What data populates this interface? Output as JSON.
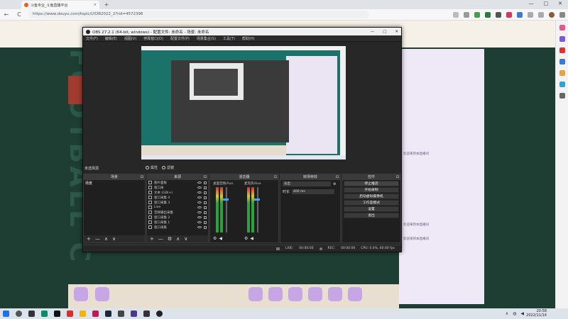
{
  "browser": {
    "tab_title": "斗鱼专业_斗鱼直播平台",
    "tab_close": "×",
    "new_tab": "+",
    "url": "https://www.douyu.com/topic/LYDB2022_2?rid=4572396",
    "nav": {
      "back": "←",
      "refresh": "C"
    },
    "window_controls": {
      "minimize": "—",
      "maximize": "□",
      "close": "✕"
    }
  },
  "page": {
    "watermark": "FOOTBALL C",
    "chat_lines": [
      "欢迎来到本直播间",
      "欢迎来到本直播间",
      "欢迎来到本直播间"
    ]
  },
  "obs": {
    "title": "OBS 27.2.1 (64-bit, windows) - 配置文件: 未命名 - 场景: 未命名",
    "window_controls": {
      "minimize": "—",
      "maximize": "□",
      "close": "✕"
    },
    "menu": [
      "文件(F)",
      "编辑(E)",
      "视图(V)",
      "停靠窗口(D)",
      "配置文件(P)",
      "场景集合(S)",
      "工具(T)",
      "帮助(H)"
    ],
    "no_source_label": "未选择源",
    "properties_label": "属性",
    "filters_label": "滤镜",
    "docks": {
      "scenes": "场景",
      "sources": "来源",
      "mixer": "混音器",
      "transitions": "转场特效",
      "controls": "控件"
    },
    "scenes": [
      "场景"
    ],
    "sources": [
      "图片面板",
      "窗口采",
      "文本 (GDI+)",
      "窗口采集 4",
      "窗口采集 3",
      "Live",
      "音频输出采集",
      "窗口采集 2",
      "窗口采集 1",
      "窗口采集"
    ],
    "mixer": {
      "ch1": "桌面音频/Aux",
      "ch2": "麦克风/Aux"
    },
    "transitions": {
      "type": "淡出",
      "duration_label": "时长",
      "duration_value": "400 ms"
    },
    "controls": [
      "停止推流",
      "开始录制",
      "启动虚拟摄像机",
      "工作室模式",
      "设置",
      "退出"
    ],
    "status": {
      "live_label": "LIVE:",
      "live_time": "00:00:00",
      "rec_label": "REC:",
      "rec_time": "00:00:00",
      "cpu": "CPU: 0.4%, 60.00 fps"
    },
    "dock_buttons": {
      "add": "+",
      "remove": "—",
      "up": "∧",
      "down": "∨"
    }
  },
  "taskbar": {
    "time": "20:58",
    "date": "2022/11/14"
  },
  "colors": {
    "obs_bg": "#272727",
    "obs_panel": "#1f1f1f",
    "page_bg": "#1e3d33",
    "accent_live": "#c9382e"
  }
}
